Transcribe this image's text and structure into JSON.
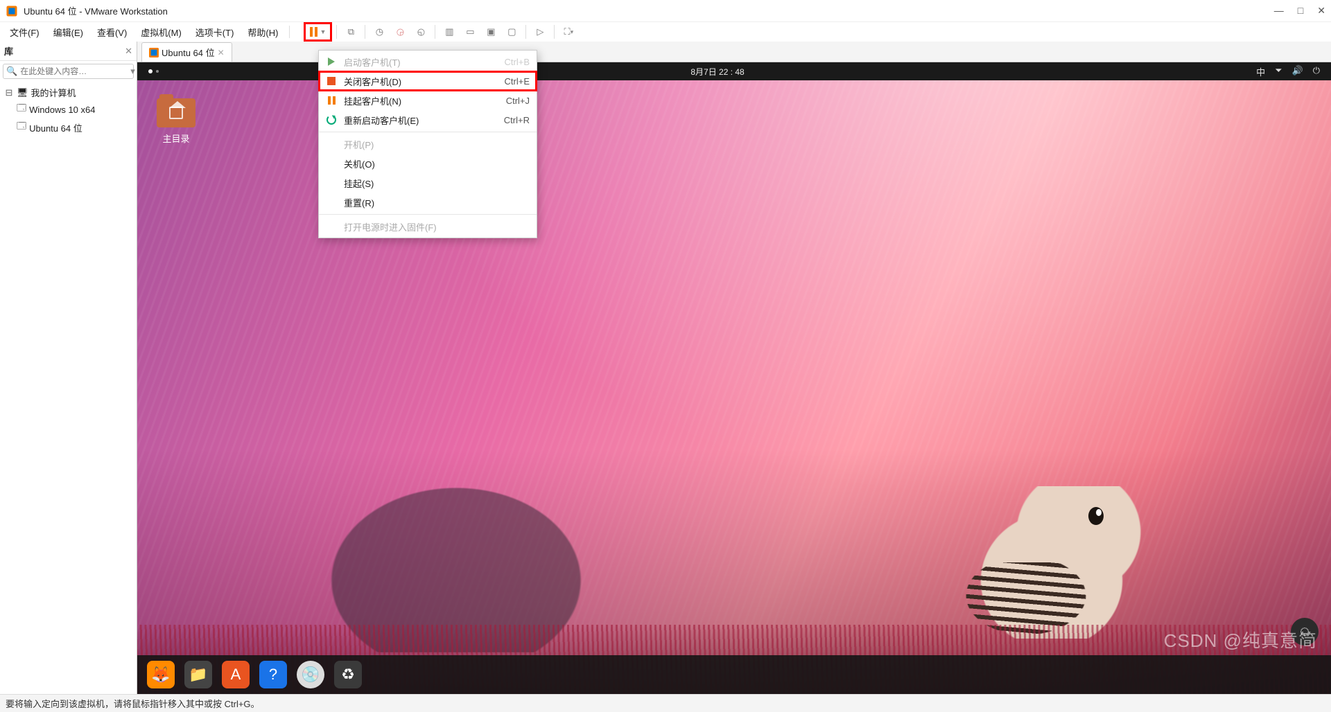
{
  "titlebar": {
    "title": "Ubuntu 64 位 - VMware Workstation"
  },
  "menubar": {
    "file": "文件(F)",
    "edit": "编辑(E)",
    "view": "查看(V)",
    "vm": "虚拟机(M)",
    "tabs": "选项卡(T)",
    "help": "帮助(H)"
  },
  "sidebar": {
    "title": "库",
    "search_placeholder": "在此处键入内容…",
    "root": "我的计算机",
    "items": [
      "Windows 10 x64",
      "Ubuntu 64 位"
    ]
  },
  "tab": {
    "label": "Ubuntu 64 位"
  },
  "ubuntu": {
    "clock": "8月7日  22 : 48",
    "tray_lang": "中",
    "home_label": "主目录"
  },
  "dropdown": {
    "start": {
      "label": "启动客户机(T)",
      "shortcut": "Ctrl+B"
    },
    "shutdown": {
      "label": "关闭客户机(D)",
      "shortcut": "Ctrl+E"
    },
    "suspend": {
      "label": "挂起客户机(N)",
      "shortcut": "Ctrl+J"
    },
    "restart": {
      "label": "重新启动客户机(E)",
      "shortcut": "Ctrl+R"
    },
    "power_on": {
      "label": "开机(P)"
    },
    "power_off": {
      "label": "关机(O)"
    },
    "suspend2": {
      "label": "挂起(S)"
    },
    "reset": {
      "label": "重置(R)"
    },
    "firmware": {
      "label": "打开电源时进入固件(F)"
    }
  },
  "statusbar": {
    "text": "要将输入定向到该虚拟机，请将鼠标指针移入其中或按 Ctrl+G。"
  },
  "watermark": "CSDN @纯真意简"
}
